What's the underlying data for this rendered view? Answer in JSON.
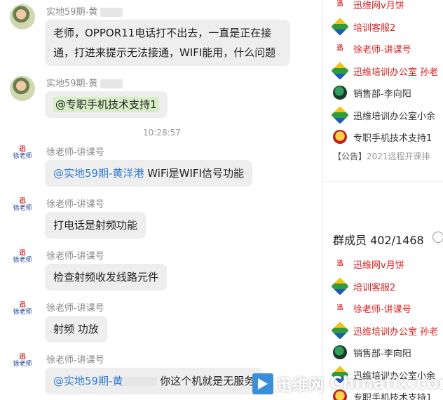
{
  "messages": [
    {
      "sender": "实地59期-黄",
      "avatar": "photo-avatar",
      "parts": [
        {
          "text": "老师，OPPOR11电话打不出去，一直是正在接"
        },
        {
          "text": "通，打进来提示无法接通，WIFI能用，什么问题"
        }
      ]
    },
    {
      "sender": "实地59期-黄",
      "avatar": "photo-avatar",
      "mention": "@专职手机技术支持1"
    },
    {
      "sender": "徐老师-讲课号",
      "avatar": "calligraphy-avatar",
      "mention": "@实地59期-黄洋港",
      "text": " WiFi是WIFI信号功能"
    },
    {
      "sender": "徐老师-讲课号",
      "avatar": "calligraphy-avatar",
      "text": "打电话是射频功能"
    },
    {
      "sender": "徐老师-讲课号",
      "avatar": "calligraphy-avatar",
      "text": "检查射频收发线路元件"
    },
    {
      "sender": "徐老师-讲课号",
      "avatar": "calligraphy-avatar",
      "text": "射频 功放"
    },
    {
      "sender": "徐老师-讲课号",
      "avatar": "calligraphy-avatar",
      "mention": "@实地59期-黄",
      "text": " 你这个机就是无服务"
    }
  ],
  "timestamp": "10:28:57",
  "avatar_text": {
    "top": "迅",
    "bottom": "徐老师"
  },
  "panel": {
    "top_members": [
      "迅维网v月饼",
      "培训客服2",
      "徐老师-讲课号",
      "迅维培训办公室 孙老",
      "销售部-李向阳",
      "迅维培训办公室小余",
      "专职手机技术支持1"
    ],
    "notice_label": "【公告】",
    "notice_text": "2021远程开课排",
    "member_count": "群成员 402/1468",
    "members": [
      "迅维网v月饼",
      "培训客服2",
      "徐老师-讲课号",
      "迅维培训办公室 孙老",
      "销售部-李向阳",
      "迅维培训办公室小余",
      "专职手机技术支持1"
    ],
    "member_icons": [
      "red-badge-icon",
      "diamond-icon",
      "red-badge-icon",
      "diamond-icon",
      "round-avatar-icon",
      "diamond-icon",
      "mascot-icon"
    ],
    "red_names": [
      true,
      true,
      true,
      true,
      false,
      false,
      false
    ]
  },
  "watermark": {
    "brand": "迅维网",
    "site": "Chinafix.com"
  },
  "colors": {
    "mention": "#2d7bd2",
    "highlight": "#d6efc7",
    "red_name": "#d81e1e",
    "bubble": "#eeeeee"
  }
}
